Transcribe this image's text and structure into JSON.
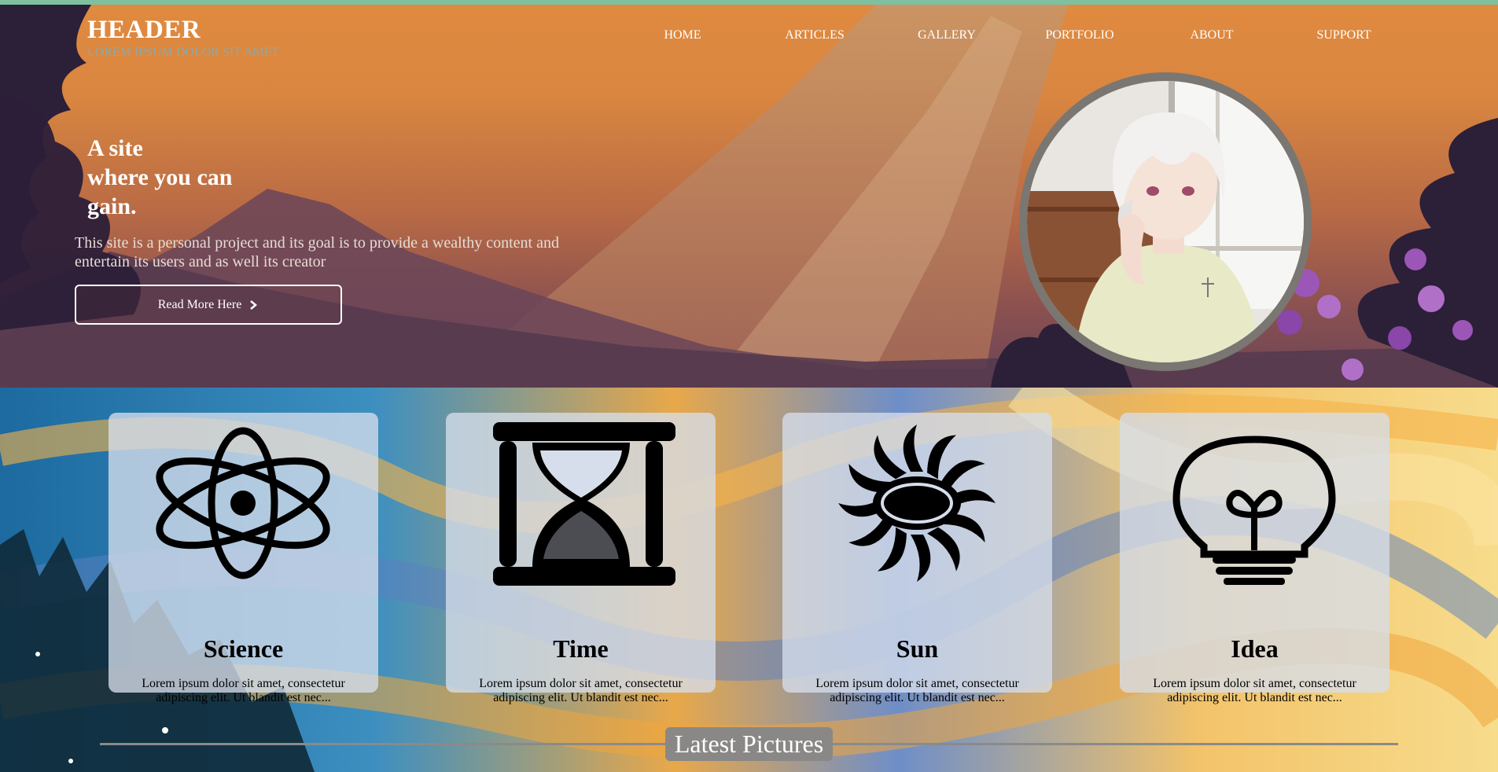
{
  "header": {
    "title": "HEADER",
    "subtitle": "LOREM IPSUM DOLOR SIT AMET"
  },
  "nav": {
    "items": [
      {
        "label": "HOME"
      },
      {
        "label": "ARTICLES"
      },
      {
        "label": "GALLERY"
      },
      {
        "label": "PORTFOLIO"
      },
      {
        "label": "ABOUT"
      },
      {
        "label": "SUPPORT"
      }
    ]
  },
  "hero": {
    "title_line1": "A site",
    "title_line2": "where you can",
    "title_line3": "gain.",
    "description": "This site is a personal project and its goal is to provide a wealthy content and entertain its users and as well its creator",
    "button_label": "Read More Here",
    "button_icon": "chevron-right-icon"
  },
  "features": {
    "cards": [
      {
        "icon": "atom-icon",
        "title": "Science",
        "text": "Lorem ipsum dolor sit amet, consectetur adipiscing elit. Ut blandit est nec..."
      },
      {
        "icon": "hourglass-icon",
        "title": "Time",
        "text": "Lorem ipsum dolor sit amet, consectetur adipiscing elit. Ut blandit est nec..."
      },
      {
        "icon": "sun-icon",
        "title": "Sun",
        "text": "Lorem ipsum dolor sit amet, consectetur adipiscing elit. Ut blandit est nec..."
      },
      {
        "icon": "lightbulb-icon",
        "title": "Idea",
        "text": "Lorem ipsum dolor sit amet, consectetur adipiscing elit. Ut blandit est nec..."
      }
    ]
  },
  "gallery": {
    "heading": "Latest Pictures"
  },
  "colors": {
    "accent_bar": "#7fc0a0",
    "subtitle": "#8da9a8",
    "card_bg": "#d6deeb",
    "heading_pill": "#8a8886"
  }
}
